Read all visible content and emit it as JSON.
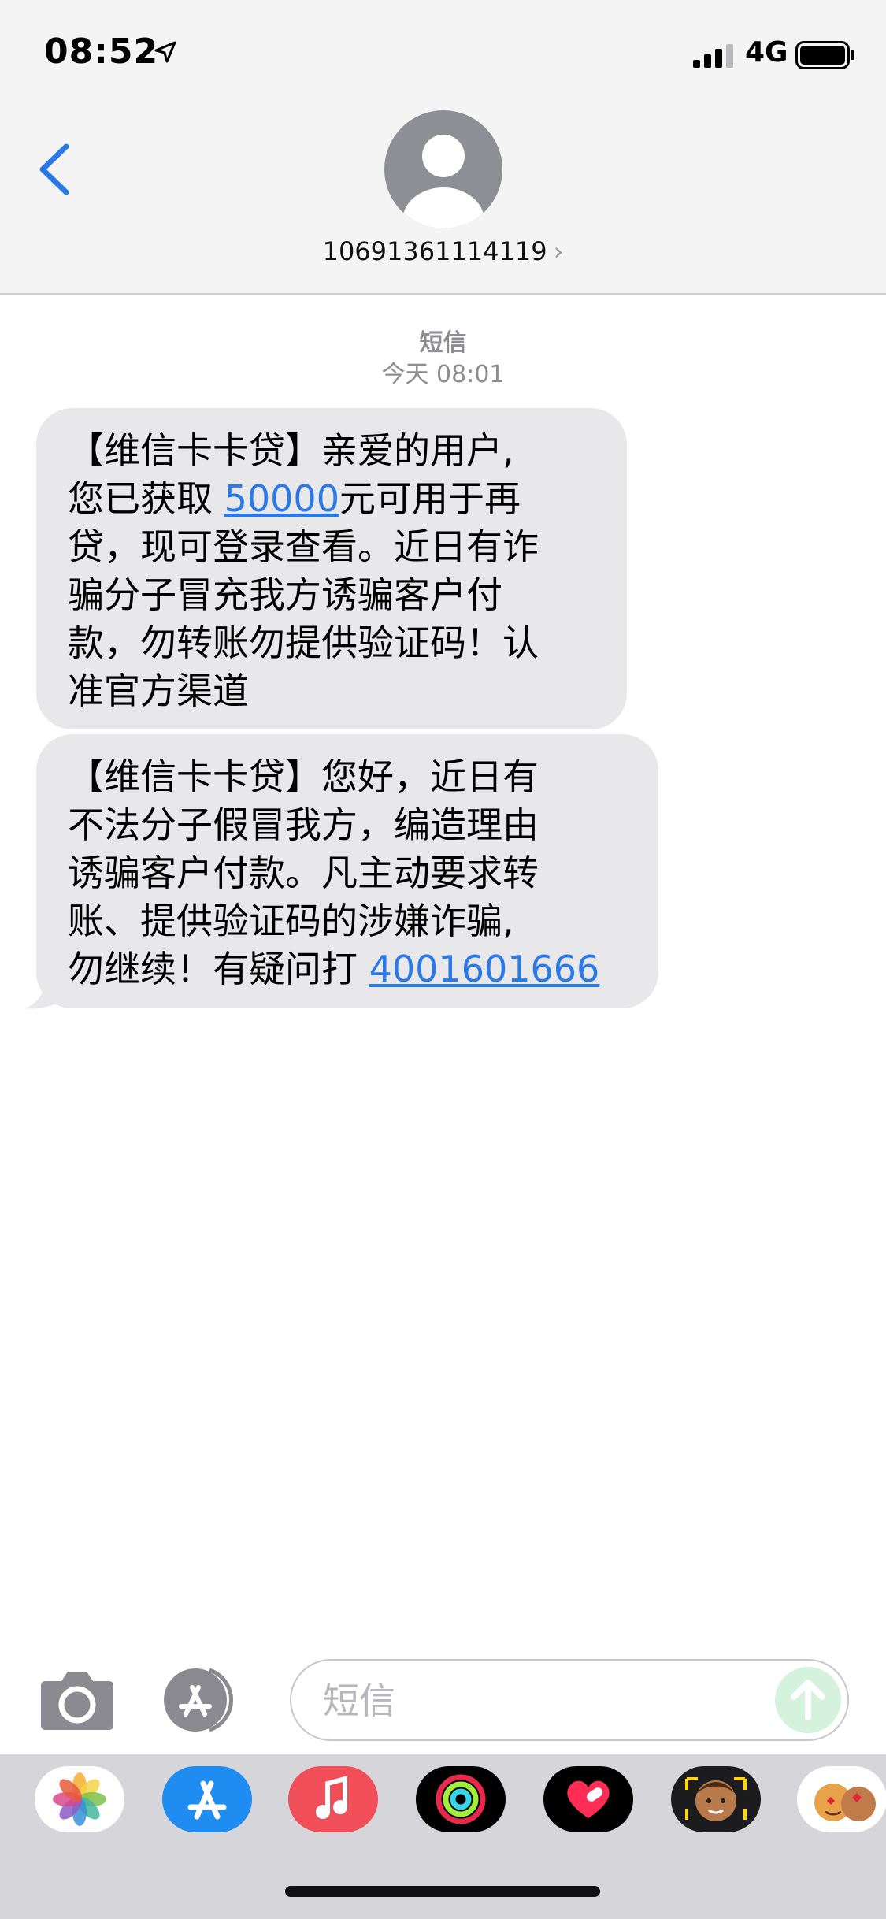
{
  "status_bar": {
    "time": "08:52",
    "network": "4G"
  },
  "header": {
    "contact_number": "10691361114119",
    "chevron": "›"
  },
  "conversation": {
    "service_label": "短信",
    "timestamp": "今天 08:01",
    "messages": [
      {
        "line1": "【维信卡卡贷】亲爱的用户,",
        "line2_pre": "您已获取 ",
        "link": "50000",
        "line2_post": "元可用于再",
        "rest": [
          "贷，现可登录查看。近日有诈",
          "骗分子冒充我方诱骗客户付",
          "款，勿转账勿提供验证码！认",
          "准官方渠道"
        ]
      },
      {
        "lines": [
          "【维信卡卡贷】您好，近日有",
          "不法分子假冒我方，编造理由",
          "诱骗客户付款。凡主动要求转",
          "账、提供验证码的涉嫌诈骗,"
        ],
        "last_pre": "勿继续！有疑问打 ",
        "link": "4001601666"
      }
    ]
  },
  "input_bar": {
    "placeholder": "短信"
  },
  "app_drawer": {
    "apps": [
      "photos-icon",
      "app-store-icon",
      "music-icon",
      "activity-icon",
      "heart-icon",
      "memoji-icon",
      "animoji-icon"
    ]
  },
  "colors": {
    "link": "#2b79e6",
    "bubble": "#e8e8ea",
    "accent": "#2b79e6"
  }
}
